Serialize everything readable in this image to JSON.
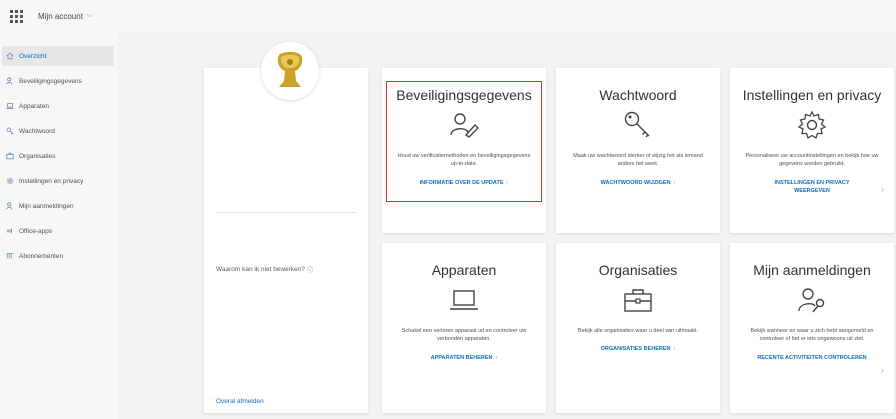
{
  "header": {
    "account_label": "Mijn account",
    "chevron": "⌵"
  },
  "sidebar": {
    "items": [
      {
        "label": "Overzicht",
        "icon": "home-icon",
        "active": true
      },
      {
        "label": "Beveiligingsgegevens",
        "icon": "person-key-icon",
        "active": false
      },
      {
        "label": "Apparaten",
        "icon": "laptop-icon",
        "active": false
      },
      {
        "label": "Wachtwoord",
        "icon": "key-icon",
        "active": false
      },
      {
        "label": "Organisaties",
        "icon": "briefcase-icon",
        "active": false
      },
      {
        "label": "Instellingen en privacy",
        "icon": "gear-icon",
        "active": false
      },
      {
        "label": "Mijn aanmeldingen",
        "icon": "person-key-icon",
        "active": false
      },
      {
        "label": "Office-apps",
        "icon": "office-icon",
        "active": false
      },
      {
        "label": "Abonnementen",
        "icon": "subscriptions-icon",
        "active": false
      }
    ]
  },
  "profile": {
    "question": "Waarom kan ik niet bewerken?",
    "signout": "Overal afmelden"
  },
  "tiles": {
    "security": {
      "title": "Beveiligingsgegevens",
      "desc": "Houd uw verificatiemethoden en beveiligingsgegevens up-to-date.",
      "link": "INFORMATIE OVER DE UPDATE"
    },
    "password": {
      "title": "Wachtwoord",
      "desc": "Maak uw wachtwoord sterker of wijzig het als iemand anders het weet.",
      "link": "WACHTWOORD WIJZIGEN"
    },
    "settings": {
      "title": "Instellingen en privacy",
      "desc": "Personaliseer uw accountinstellingen en bekijk hoe uw gegevens worden gebruikt.",
      "link": "INSTELLINGEN EN PRIVACY WEERGEVEN"
    },
    "devices": {
      "title": "Apparaten",
      "desc": "Schakel een verloren apparaat uit en controleer uw verbonden apparaten.",
      "link": "APPARATEN BEHEREN"
    },
    "orgs": {
      "title": "Organisaties",
      "desc": "Bekijk alle organisaties waar u deel van uitmaakt.",
      "link": "ORGANISATIES BEHEREN"
    },
    "signins": {
      "title": "Mijn aanmeldingen",
      "desc": "Bekijk wanneer en waar u zich hebt aangemeld en controleer of het er iets ongewoons uit ziet.",
      "link": "RECENTE ACTIVITEITEN CONTROLEREN"
    }
  },
  "colors": {
    "accent": "#0f6cbd",
    "highlight": "#d13438",
    "avatar_gold": "#c9a227"
  }
}
